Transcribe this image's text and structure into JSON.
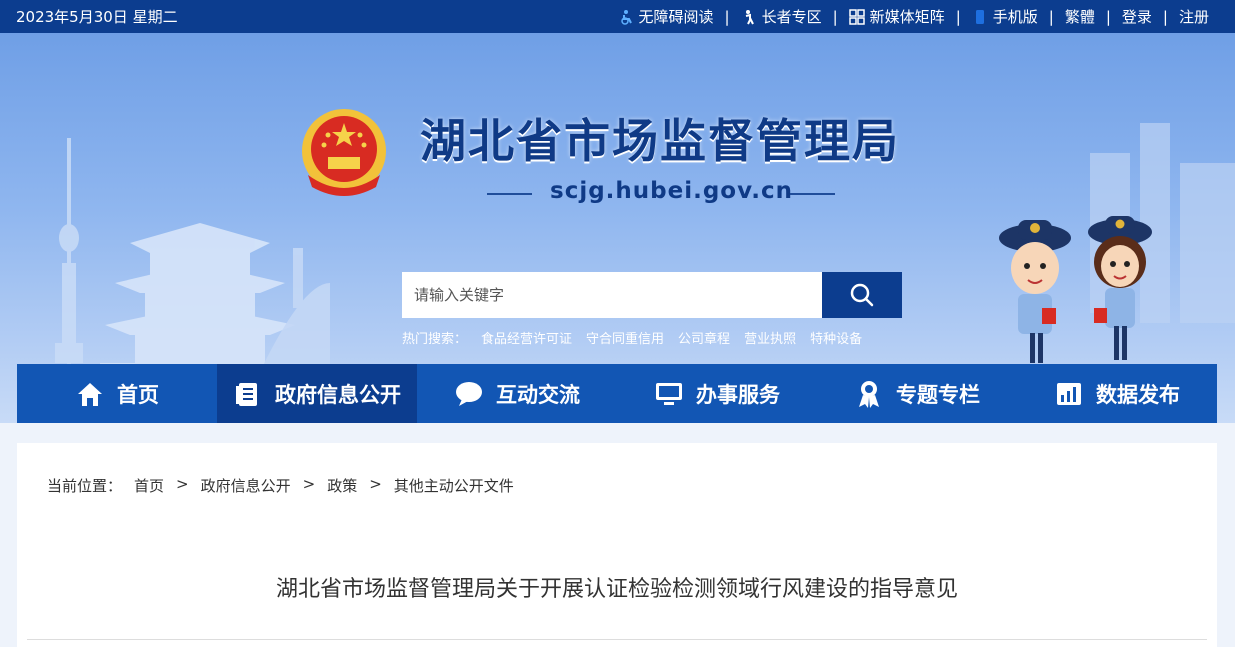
{
  "topbar": {
    "date": "2023年5月30日 星期二",
    "links": [
      "无障碍阅读",
      "长者专区",
      "新媒体矩阵",
      "手机版",
      "繁體",
      "登录",
      "注册"
    ],
    "icons": [
      "wheelchair-icon",
      "elder-icon",
      "qr-grid-icon",
      "phone-icon"
    ]
  },
  "header": {
    "title": "湖北省市场监督管理局",
    "domain": "scjg.hubei.gov.cn"
  },
  "search": {
    "placeholder": "请输入关键字",
    "hot_label": "热门搜索：",
    "hot_items": [
      "食品经营许可证",
      "守合同重信用",
      "公司章程",
      "营业执照",
      "特种设备"
    ]
  },
  "nav": {
    "items": [
      {
        "label": "首页",
        "icon": "home-icon"
      },
      {
        "label": "政府信息公开",
        "icon": "document-icon"
      },
      {
        "label": "互动交流",
        "icon": "chat-bubble-icon"
      },
      {
        "label": "办事服务",
        "icon": "monitor-icon"
      },
      {
        "label": "专题专栏",
        "icon": "award-ribbon-icon"
      },
      {
        "label": "数据发布",
        "icon": "bar-chart-icon"
      }
    ],
    "active_index": 1
  },
  "breadcrumb": {
    "label": "当前位置：",
    "items": [
      "首页",
      "政府信息公开",
      "政策",
      "其他主动公开文件"
    ],
    "separator": ">"
  },
  "article": {
    "title": "湖北省市场监督管理局关于开展认证检验检测领域行风建设的指导意见"
  },
  "colors": {
    "dark_blue": "#0c3d8f",
    "nav_blue": "#1256b4",
    "banner_light": "#c8dbf7"
  }
}
